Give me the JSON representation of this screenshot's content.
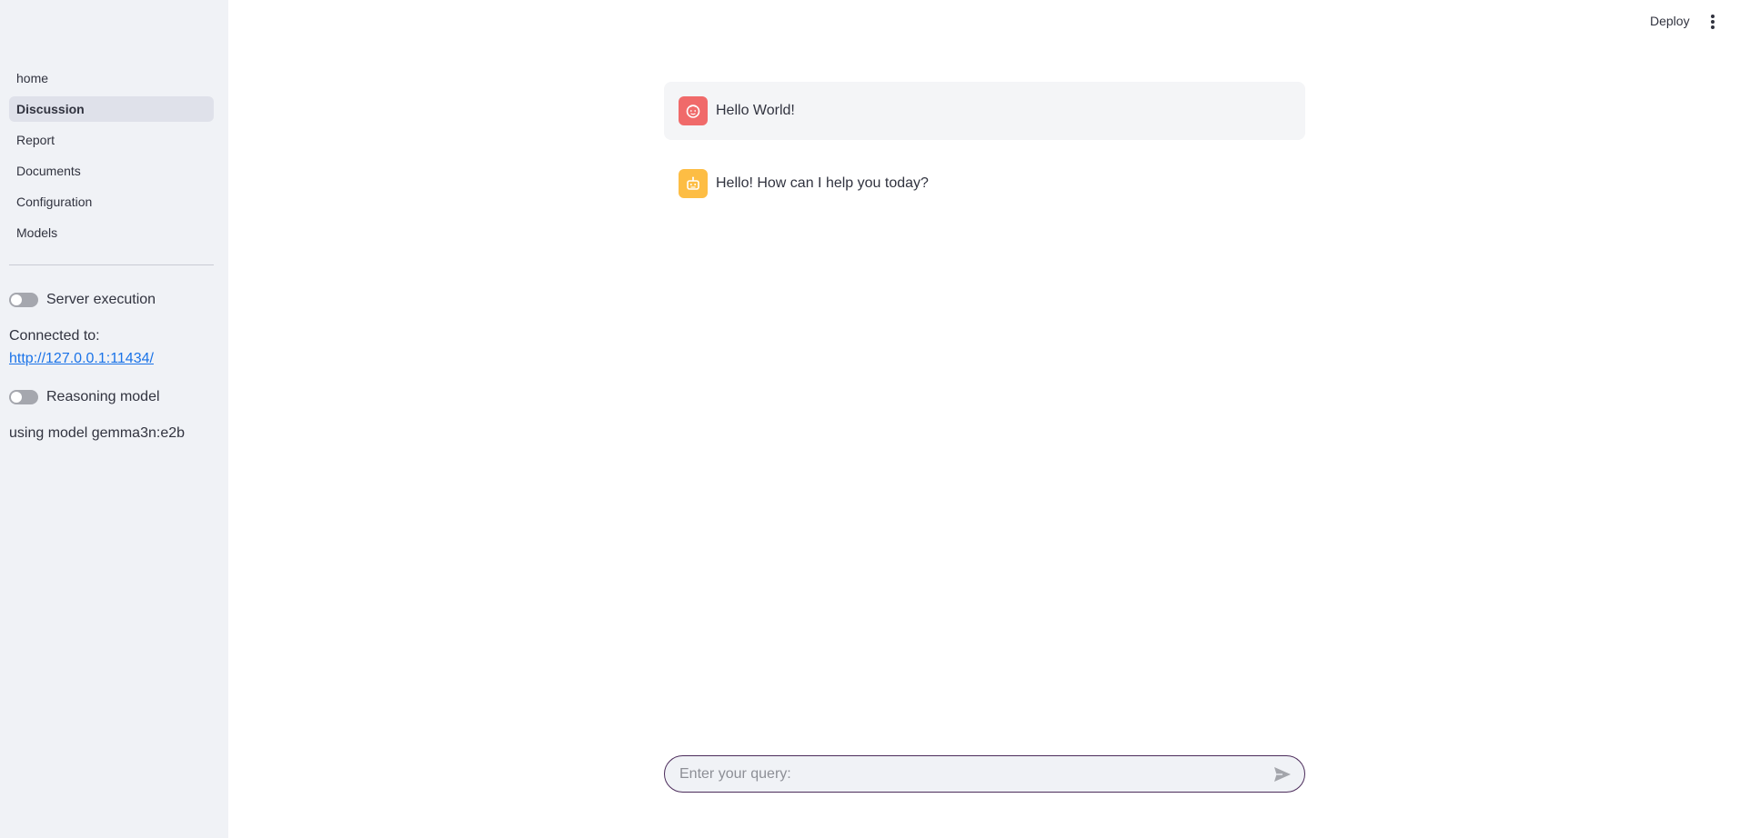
{
  "sidebar": {
    "nav_items": [
      {
        "label": "home",
        "active": false
      },
      {
        "label": "Discussion",
        "active": true
      },
      {
        "label": "Report",
        "active": false
      },
      {
        "label": "Documents",
        "active": false
      },
      {
        "label": "Configuration",
        "active": false
      },
      {
        "label": "Models",
        "active": false
      }
    ],
    "server_execution_label": "Server execution",
    "server_execution_on": false,
    "connected_label": "Connected to:",
    "connected_url": "http://127.0.0.1:11434/",
    "reasoning_label": "Reasoning model",
    "reasoning_on": false,
    "model_text": "using model gemma3n:e2b"
  },
  "header": {
    "deploy_label": "Deploy"
  },
  "chat": {
    "messages": [
      {
        "role": "user",
        "avatar_icon": "user-face-icon",
        "text": "Hello World!"
      },
      {
        "role": "assistant",
        "avatar_icon": "robot-icon",
        "text": "Hello! How can I help you today?"
      }
    ],
    "input_placeholder": "Enter your query:",
    "input_value": ""
  },
  "colors": {
    "sidebar_bg": "#f0f2f6",
    "user_avatar": "#f06a6a",
    "assistant_avatar": "#fdbd44",
    "link": "#1a73e8"
  }
}
